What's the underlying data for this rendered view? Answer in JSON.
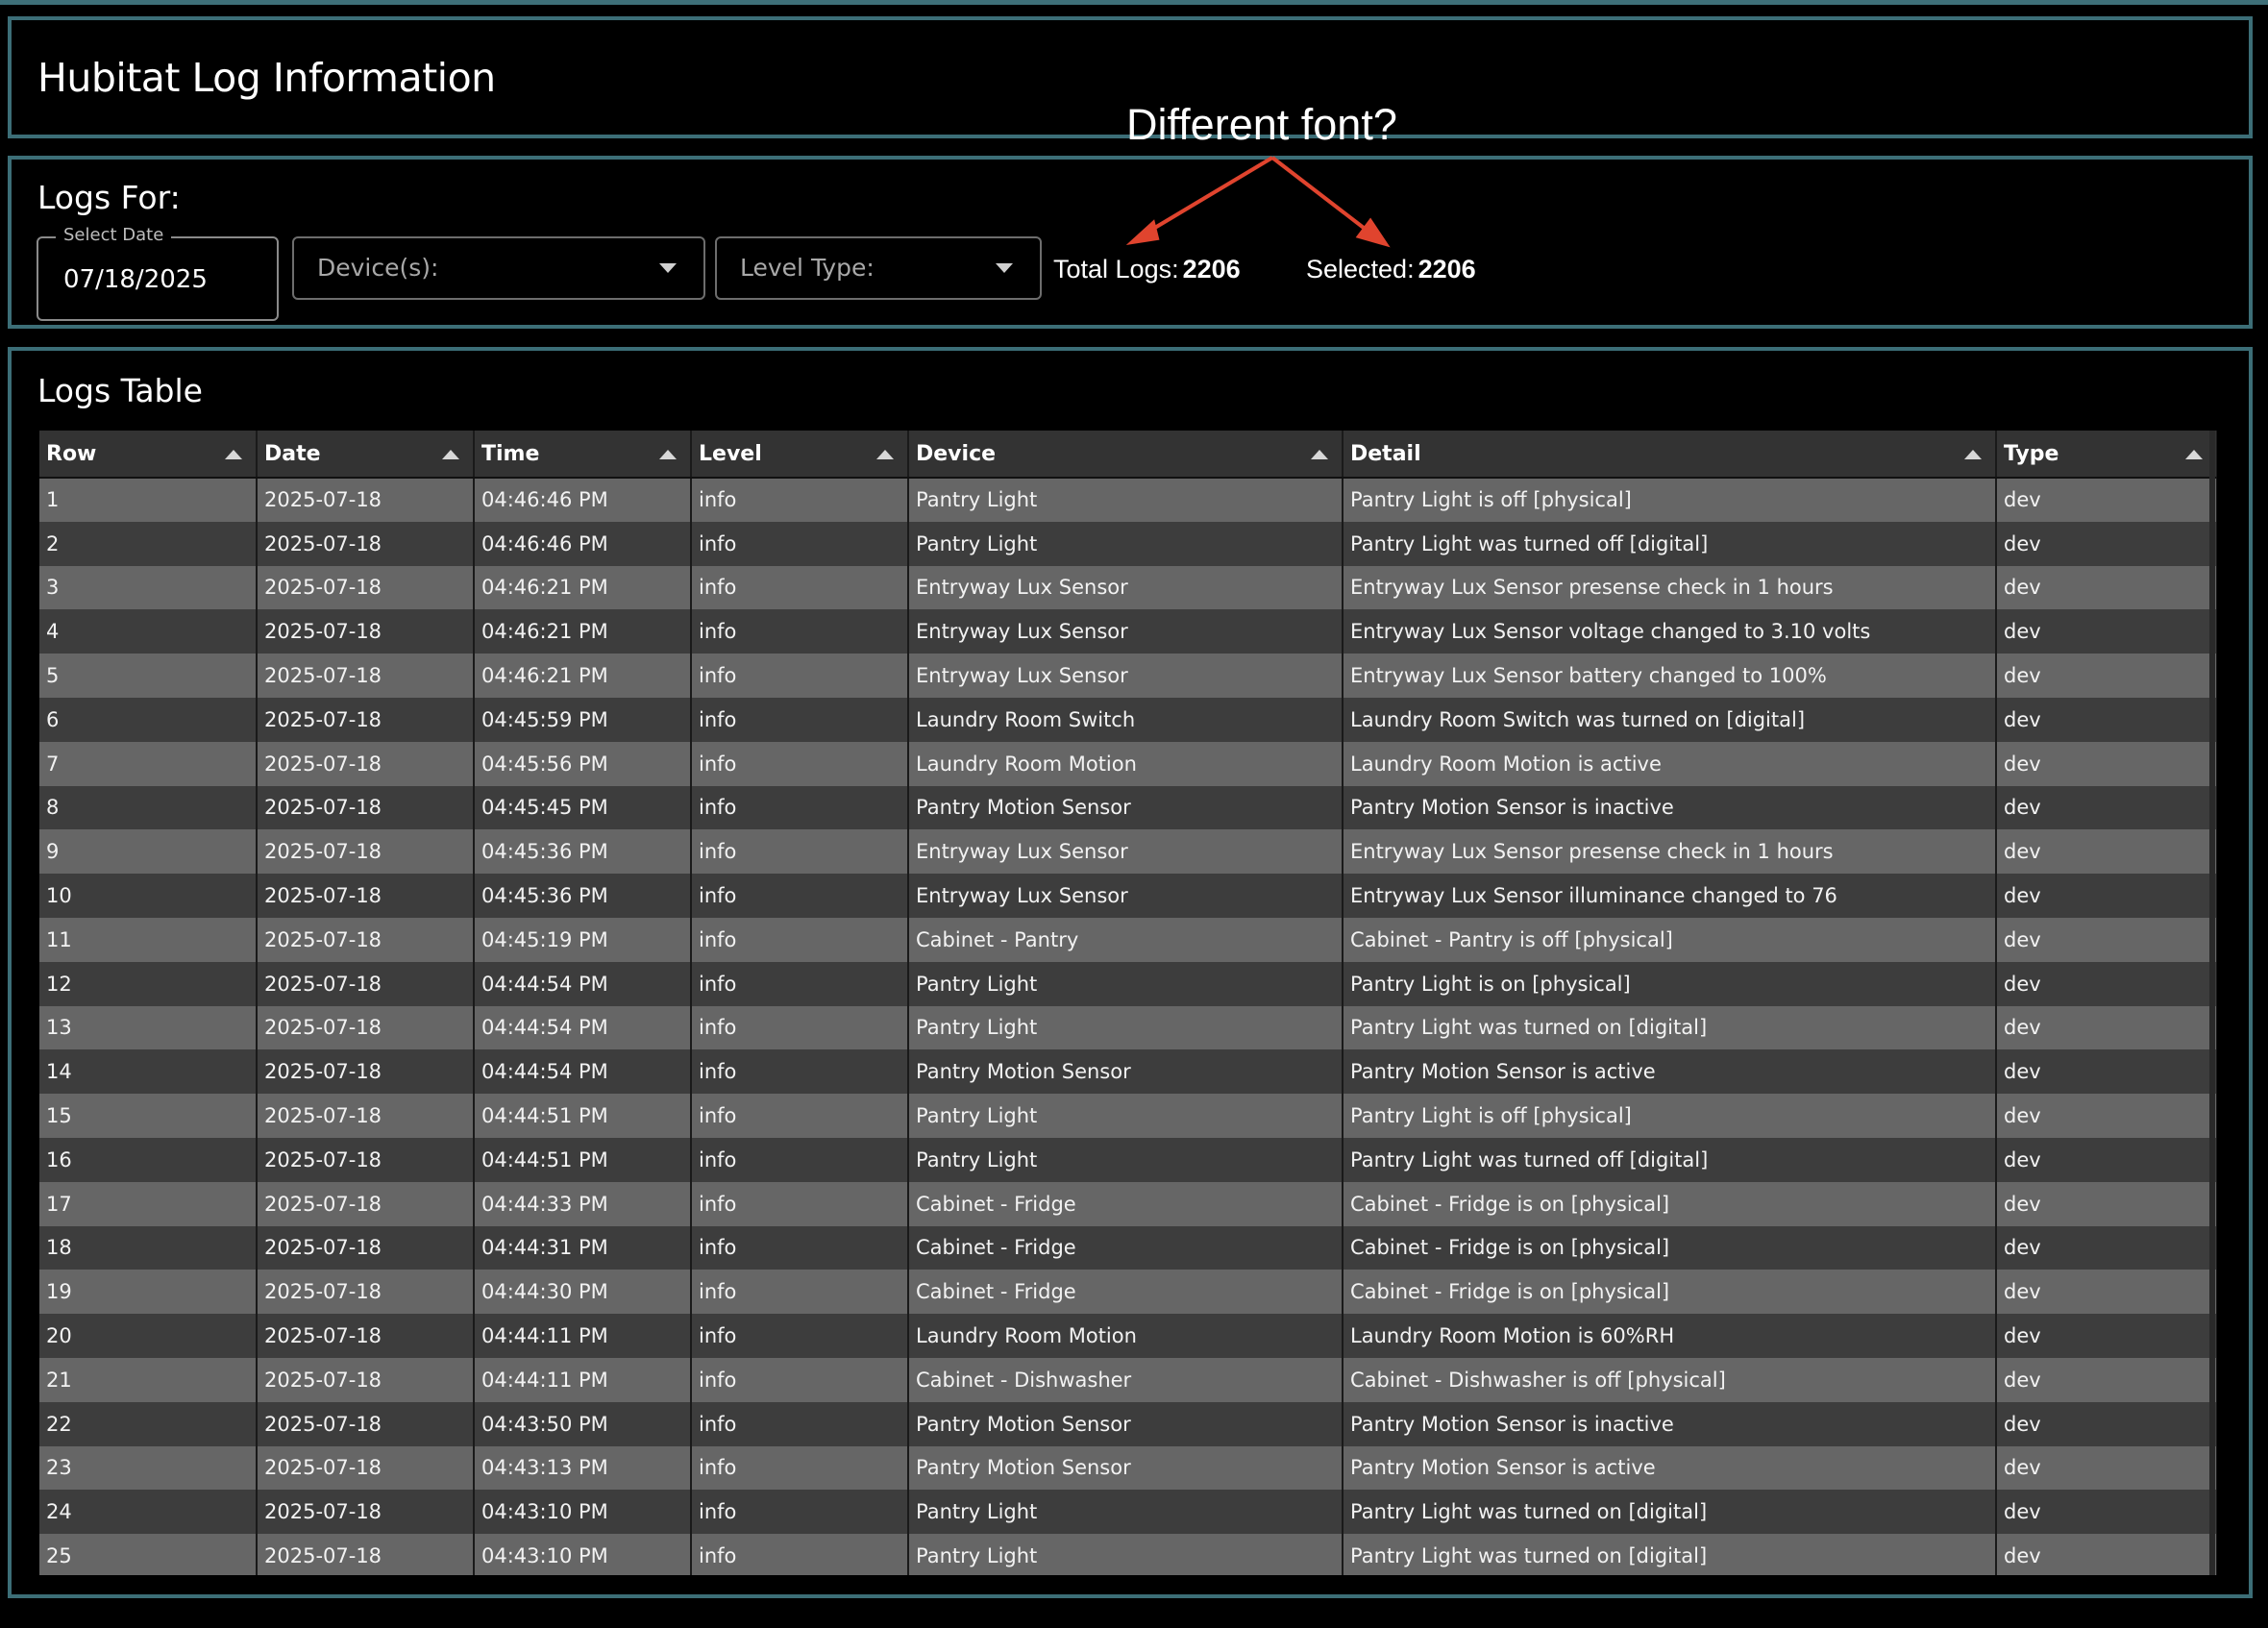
{
  "header": {
    "title": "Hubitat Log Information"
  },
  "filters": {
    "title": "Logs For:",
    "date_legend": "Select Date",
    "date_value": "07/18/2025",
    "devices_label": "Device(s):",
    "level_label": "Level Type:",
    "total_label": "Total Logs:",
    "total_value": "2206",
    "selected_label": "Selected:",
    "selected_value": "2206"
  },
  "annotation": {
    "text": "Different font?",
    "color": "#e0442e"
  },
  "table": {
    "title": "Logs Table",
    "columns": [
      "Row",
      "Date",
      "Time",
      "Level",
      "Device",
      "Detail",
      "Type"
    ],
    "rows": [
      [
        "1",
        "2025-07-18",
        "04:46:46 PM",
        "info",
        "Pantry Light",
        "Pantry Light is off [physical]",
        "dev"
      ],
      [
        "2",
        "2025-07-18",
        "04:46:46 PM",
        "info",
        "Pantry Light",
        "Pantry Light was turned off [digital]",
        "dev"
      ],
      [
        "3",
        "2025-07-18",
        "04:46:21 PM",
        "info",
        "Entryway Lux Sensor",
        "Entryway Lux Sensor presense check in 1 hours",
        "dev"
      ],
      [
        "4",
        "2025-07-18",
        "04:46:21 PM",
        "info",
        "Entryway Lux Sensor",
        "Entryway Lux Sensor voltage changed to 3.10 volts",
        "dev"
      ],
      [
        "5",
        "2025-07-18",
        "04:46:21 PM",
        "info",
        "Entryway Lux Sensor",
        "Entryway Lux Sensor battery changed to 100%",
        "dev"
      ],
      [
        "6",
        "2025-07-18",
        "04:45:59 PM",
        "info",
        "Laundry Room Switch",
        "Laundry Room Switch was turned on [digital]",
        "dev"
      ],
      [
        "7",
        "2025-07-18",
        "04:45:56 PM",
        "info",
        "Laundry Room Motion",
        "Laundry Room Motion is active",
        "dev"
      ],
      [
        "8",
        "2025-07-18",
        "04:45:45 PM",
        "info",
        "Pantry Motion Sensor",
        "Pantry Motion Sensor is inactive",
        "dev"
      ],
      [
        "9",
        "2025-07-18",
        "04:45:36 PM",
        "info",
        "Entryway Lux Sensor",
        "Entryway Lux Sensor presense check in 1 hours",
        "dev"
      ],
      [
        "10",
        "2025-07-18",
        "04:45:36 PM",
        "info",
        "Entryway Lux Sensor",
        "Entryway Lux Sensor illuminance changed to 76",
        "dev"
      ],
      [
        "11",
        "2025-07-18",
        "04:45:19 PM",
        "info",
        "Cabinet - Pantry",
        "Cabinet - Pantry is off [physical]",
        "dev"
      ],
      [
        "12",
        "2025-07-18",
        "04:44:54 PM",
        "info",
        "Pantry Light",
        "Pantry Light is on [physical]",
        "dev"
      ],
      [
        "13",
        "2025-07-18",
        "04:44:54 PM",
        "info",
        "Pantry Light",
        "Pantry Light was turned on [digital]",
        "dev"
      ],
      [
        "14",
        "2025-07-18",
        "04:44:54 PM",
        "info",
        "Pantry Motion Sensor",
        "Pantry Motion Sensor is active",
        "dev"
      ],
      [
        "15",
        "2025-07-18",
        "04:44:51 PM",
        "info",
        "Pantry Light",
        "Pantry Light is off [physical]",
        "dev"
      ],
      [
        "16",
        "2025-07-18",
        "04:44:51 PM",
        "info",
        "Pantry Light",
        "Pantry Light was turned off [digital]",
        "dev"
      ],
      [
        "17",
        "2025-07-18",
        "04:44:33 PM",
        "info",
        "Cabinet - Fridge",
        "Cabinet - Fridge is on [physical]",
        "dev"
      ],
      [
        "18",
        "2025-07-18",
        "04:44:31 PM",
        "info",
        "Cabinet - Fridge",
        "Cabinet - Fridge is on [physical]",
        "dev"
      ],
      [
        "19",
        "2025-07-18",
        "04:44:30 PM",
        "info",
        "Cabinet - Fridge",
        "Cabinet - Fridge is on [physical]",
        "dev"
      ],
      [
        "20",
        "2025-07-18",
        "04:44:11 PM",
        "info",
        "Laundry Room Motion",
        "Laundry Room Motion is 60%RH",
        "dev"
      ],
      [
        "21",
        "2025-07-18",
        "04:44:11 PM",
        "info",
        "Cabinet - Dishwasher",
        "Cabinet - Dishwasher is off [physical]",
        "dev"
      ],
      [
        "22",
        "2025-07-18",
        "04:43:50 PM",
        "info",
        "Pantry Motion Sensor",
        "Pantry Motion Sensor is inactive",
        "dev"
      ],
      [
        "23",
        "2025-07-18",
        "04:43:13 PM",
        "info",
        "Pantry Motion Sensor",
        "Pantry Motion Sensor is active",
        "dev"
      ],
      [
        "24",
        "2025-07-18",
        "04:43:10 PM",
        "info",
        "Pantry Light",
        "Pantry Light was turned on [digital]",
        "dev"
      ],
      [
        "25",
        "2025-07-18",
        "04:43:10 PM",
        "info",
        "Pantry Light",
        "Pantry Light was turned on [digital]",
        "dev"
      ]
    ]
  }
}
